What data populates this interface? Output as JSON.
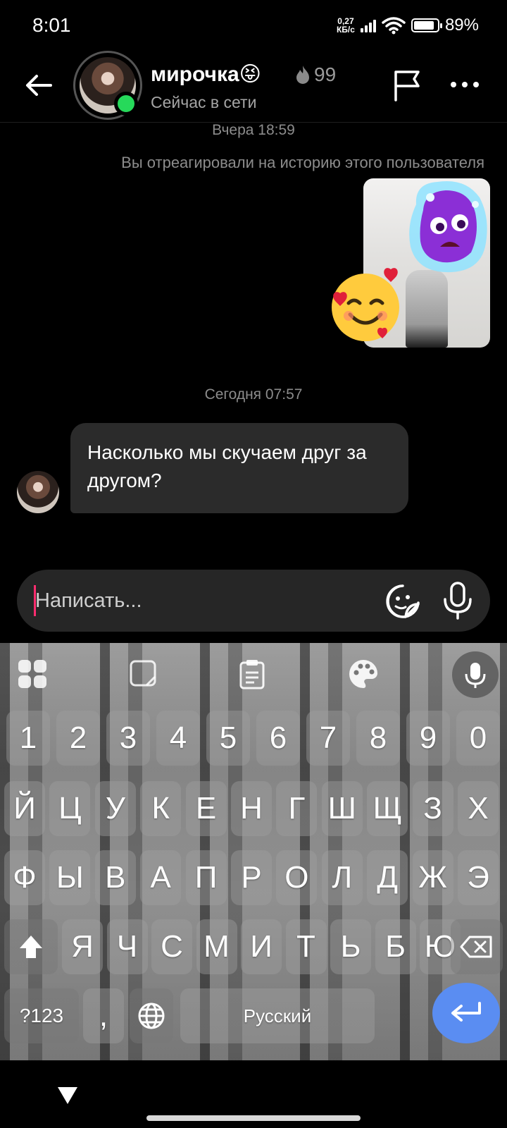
{
  "status_bar": {
    "time": "8:01",
    "net_speed_value": "0,27",
    "net_speed_unit": "КБ/с",
    "battery_percent": "89%",
    "battery_level": 0.89
  },
  "header": {
    "username": "мирочка😝",
    "streak_count": "99",
    "presence": "Сейчас в сети"
  },
  "chat": {
    "timestamp_yesterday": "Вчера 18:59",
    "story_reaction_note": "Вы отреагировали на историю этого пользователя",
    "timestamp_today": "Сегодня 07:57",
    "incoming_message": "Насколько мы скучаем друг за другом?"
  },
  "composer": {
    "placeholder": "Написать..."
  },
  "keyboard": {
    "number_row": [
      "1",
      "2",
      "3",
      "4",
      "5",
      "6",
      "7",
      "8",
      "9",
      "0"
    ],
    "row1": [
      "Й",
      "Ц",
      "У",
      "К",
      "Е",
      "Н",
      "Г",
      "Ш",
      "Щ",
      "З",
      "Х"
    ],
    "row2": [
      "Ф",
      "Ы",
      "В",
      "А",
      "П",
      "Р",
      "О",
      "Л",
      "Д",
      "Ж",
      "Э"
    ],
    "row3": [
      "Я",
      "Ч",
      "С",
      "М",
      "И",
      "Т",
      "Ь",
      "Б",
      "Ю"
    ],
    "symbols_label": "?123",
    "comma_label": ",",
    "space_label": "Русский"
  }
}
